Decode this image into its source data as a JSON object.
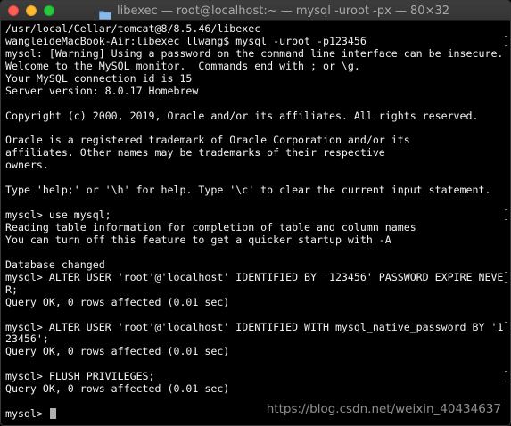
{
  "window": {
    "title": "libexec — root@localhost:~ — mysql -uroot -px — 80×32",
    "background": "#000000",
    "foreground": "#f2f2f2"
  },
  "titlebar": {
    "buttons": [
      "close",
      "minimize",
      "zoom"
    ],
    "icon": "folder-icon"
  },
  "terminal": {
    "lines": [
      "/usr/local/Cellar/tomcat@8/8.5.46/libexec",
      "wangleideMacBook-Air:libexec llwang$ mysql -uroot -p123456",
      "mysql: [Warning] Using a password on the command line interface can be insecure.",
      "Welcome to the MySQL monitor.  Commands end with ; or \\g.",
      "Your MySQL connection id is 15",
      "Server version: 8.0.17 Homebrew",
      "",
      "Copyright (c) 2000, 2019, Oracle and/or its affiliates. All rights reserved.",
      "",
      "Oracle is a registered trademark of Oracle Corporation and/or its",
      "affiliates. Other names may be trademarks of their respective",
      "owners.",
      "",
      "Type 'help;' or '\\h' for help. Type '\\c' to clear the current input statement.",
      "",
      "mysql> use mysql;",
      "Reading table information for completion of table and column names",
      "You can turn off this feature to get a quicker startup with -A",
      "",
      "Database changed",
      "mysql> ALTER USER 'root'@'localhost' IDENTIFIED BY '123456' PASSWORD EXPIRE NEVE",
      "R;",
      "Query OK, 0 rows affected (0.01 sec)",
      "",
      "mysql> ALTER USER 'root'@'localhost' IDENTIFIED WITH mysql_native_password BY '1",
      "23456';",
      "Query OK, 0 rows affected (0.01 sec)",
      "",
      "mysql> FLUSH PRIVILEGES;",
      "Query OK, 0 rows affected (0.01 sec)",
      "",
      "mysql> "
    ],
    "marked_lines": [
      1,
      15,
      20,
      24,
      28,
      31
    ]
  },
  "watermark": {
    "text": "https://blog.csdn.net/weixin_40434637"
  }
}
